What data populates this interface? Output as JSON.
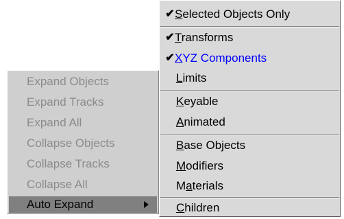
{
  "left_menu": {
    "items": [
      {
        "label": "Expand Objects"
      },
      {
        "label": "Expand Tracks"
      },
      {
        "label": "Expand All"
      },
      {
        "label": "Collapse Objects"
      },
      {
        "label": "Collapse Tracks"
      },
      {
        "label": "Collapse All"
      }
    ],
    "auto_expand": {
      "label": "Auto Expand"
    }
  },
  "right_menu": {
    "items": [
      {
        "key": "S",
        "rest": "elected Objects Only",
        "checked": true
      },
      {
        "key": "T",
        "rest": "ransforms",
        "checked": true
      },
      {
        "key": "X",
        "rest": "YZ Components",
        "checked": true,
        "color": "#0000ff"
      },
      {
        "key": "L",
        "rest": "imits",
        "checked": false
      },
      {
        "key": "K",
        "rest": "eyable",
        "checked": false
      },
      {
        "key": "A",
        "rest": "nimated",
        "checked": false
      },
      {
        "key": "B",
        "rest": "ase Objects",
        "checked": false
      },
      {
        "key": "M",
        "rest": "odifiers",
        "checked": false
      },
      {
        "pre": "M",
        "key": "a",
        "rest": "terials",
        "checked": false
      },
      {
        "key": "C",
        "rest": "hildren",
        "checked": false
      }
    ]
  },
  "check_mark": "✔"
}
